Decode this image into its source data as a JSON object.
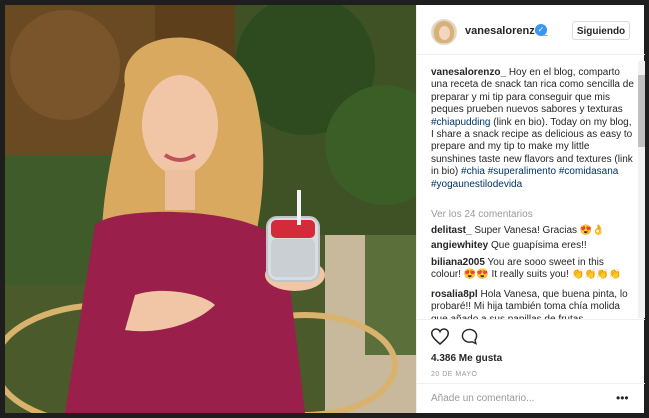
{
  "post": {
    "username": "vanesalorenzo_",
    "follow_label": "Siguiendo",
    "caption_user": "vanesalorenzo_",
    "caption_text": " Hoy en el blog, comparto una receta de snack tan rica como sencilla de preparar y mi tip para conseguir que mis peques prueben nuevos sabores y texturas ",
    "caption_tag1": "#chiapudding",
    "caption_text2": " (link en bio). Today on my blog, I share a snack recipe as delicious as easy to prepare and my tip to make my little sunshines taste new flavors and textures (link in bio) ",
    "caption_tag2": "#chia",
    "caption_tag3": "#superalimento",
    "caption_tag4": "#comidasana",
    "caption_tag5": "#yogaunestilodevida",
    "view_all": "Ver los 24 comentarios",
    "comments": [
      {
        "user": "delitast_",
        "text": " Super Vanesa! Gracias 😍👌"
      },
      {
        "user": "angiewhitey",
        "text": " Que guapísima eres!!"
      },
      {
        "user": "biliana2005",
        "text": " You are sooo sweet in this colour! 😍😍 It really suits you! 👏👏👏👏"
      },
      {
        "user": "rosalia8pl",
        "text": " Hola Vanesa, que buena pinta, lo probaré!! Mi hija también toma chía molida que añado a sus papillas de frutas"
      }
    ],
    "likes": "4.386 Me gusta",
    "date": "20 DE MAYO",
    "add_comment_placeholder": "Añade un comentario...",
    "more_label": "•••"
  },
  "icons": {
    "like": "heart-icon",
    "comment": "comment-icon",
    "verified": "verified-badge-icon"
  },
  "colors": {
    "hashtag": "#003569",
    "verified": "#3897f0",
    "top_bg": "#1e1e1e"
  }
}
